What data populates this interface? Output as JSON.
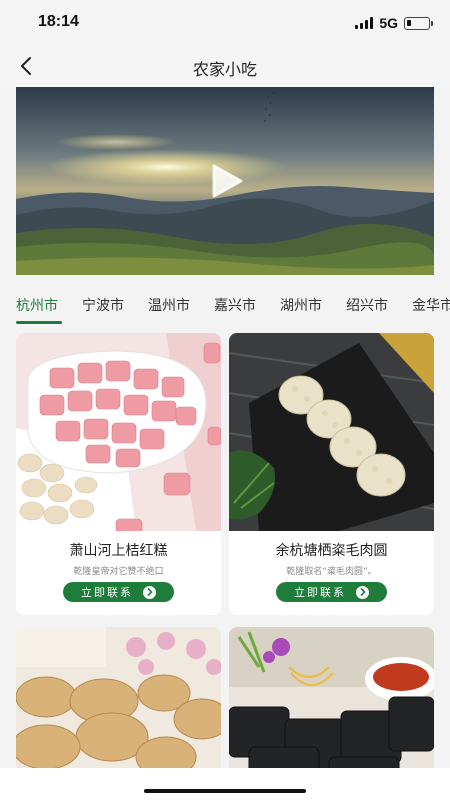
{
  "status_bar": {
    "time": "18:14",
    "network": "5G",
    "battery_level": 0.2
  },
  "header": {
    "title": "农家小吃",
    "back_icon": "chevron-left-icon"
  },
  "banner": {
    "type": "video",
    "play_icon": "play-icon"
  },
  "city_tabs": {
    "active_index": 0,
    "accent_color": "#1d7c3a",
    "items": [
      "杭州市",
      "宁波市",
      "温州市",
      "嘉兴市",
      "湖州市",
      "绍兴市",
      "金华市"
    ]
  },
  "cards": [
    {
      "title": "萧山河上桔红糕",
      "desc": "乾隆皇帝对它赞不绝口",
      "button": "立即联系"
    },
    {
      "title": "余杭塘栖粢毛肉圆",
      "desc": "乾隆取名“粢毛肉圆”。",
      "button": "立即联系"
    },
    {
      "title": "",
      "desc": "",
      "button": ""
    },
    {
      "title": "",
      "desc": "",
      "button": ""
    }
  ],
  "colors": {
    "brand_green": "#1f7d3c",
    "background": "#f3f3f3"
  }
}
